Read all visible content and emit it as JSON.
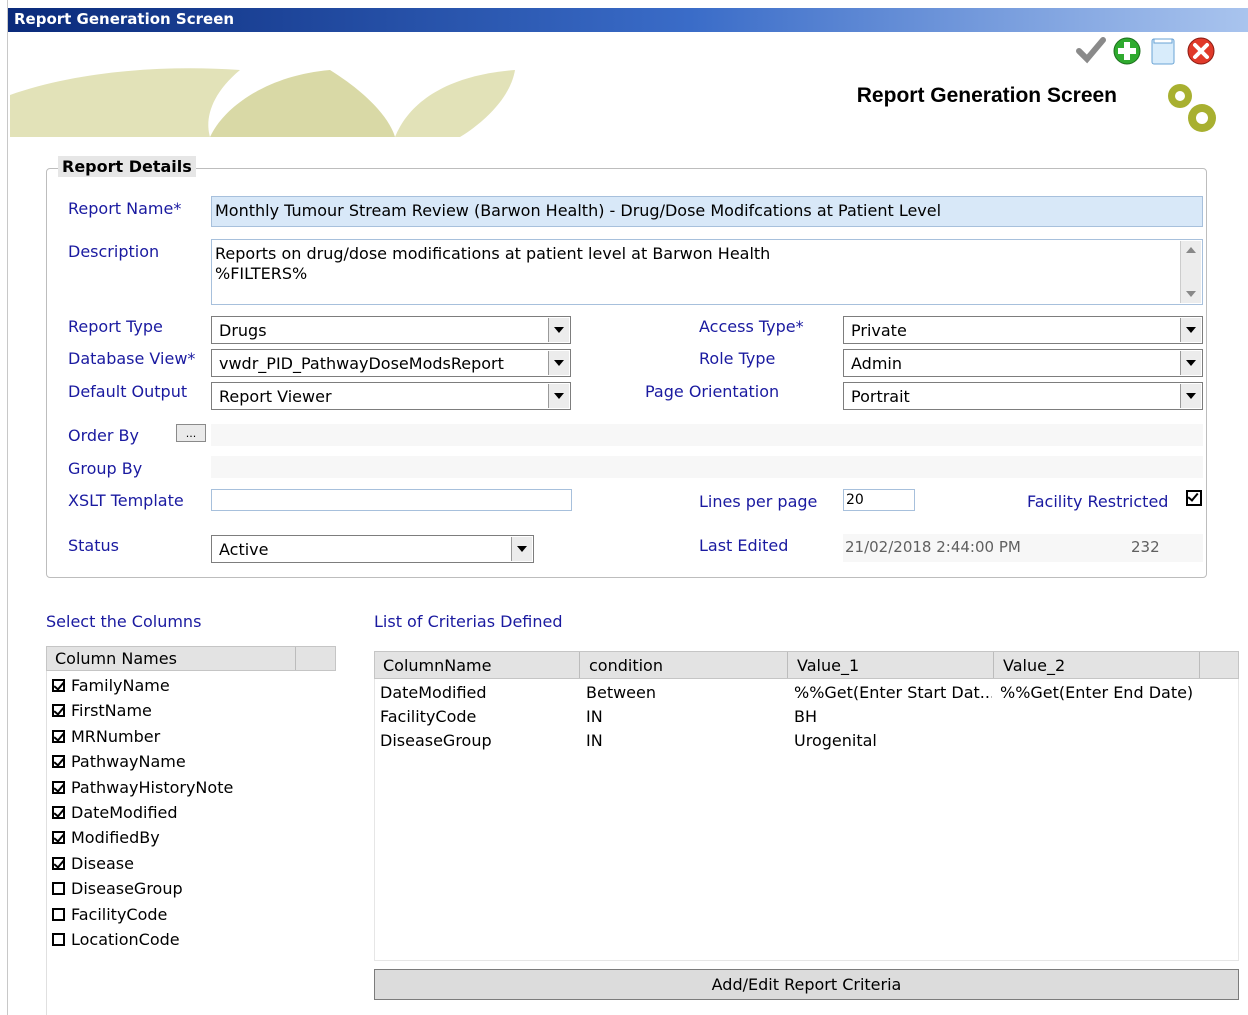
{
  "window": {
    "title": "Report Generation Screen"
  },
  "header": {
    "title": "Report Generation Screen"
  },
  "toolbar": {
    "icons": [
      "save-check-icon",
      "add-icon",
      "clear-icon",
      "close-icon"
    ]
  },
  "details": {
    "group_title": "Report Details",
    "report_name_label": "Report Name*",
    "report_name_value": "Monthly Tumour Stream Review (Barwon Health) - Drug/Dose Modifcations at Patient Level",
    "description_label": "Description",
    "description_line1": "Reports on drug/dose modifications at patient level at Barwon Health",
    "description_line2": "%FILTERS%",
    "report_type_label": "Report Type",
    "report_type_value": "Drugs",
    "database_view_label": "Database View*",
    "database_view_value": "vwdr_PID_PathwayDoseModsReport",
    "default_output_label": "Default Output",
    "default_output_value": "Report Viewer",
    "access_type_label": "Access Type*",
    "access_type_value": "Private",
    "role_type_label": "Role Type",
    "role_type_value": "Admin",
    "page_orientation_label": "Page Orientation",
    "page_orientation_value": "Portrait",
    "order_by_label": "Order By",
    "order_by_button": "...",
    "group_by_label": "Group By",
    "xslt_label": "XSLT Template",
    "lines_per_page_label": "Lines per page",
    "lines_per_page_value": "20",
    "facility_restricted_label": "Facility Restricted",
    "facility_restricted_checked": true,
    "status_label": "Status",
    "status_value": "Active",
    "last_edited_label": "Last Edited",
    "last_edited_value": "21/02/2018 2:44:00 PM",
    "last_edited_id": "232"
  },
  "columns": {
    "title": "Select the Columns",
    "header": "Column Names",
    "items": [
      {
        "name": "FamilyName",
        "checked": true
      },
      {
        "name": "FirstName",
        "checked": true
      },
      {
        "name": "MRNumber",
        "checked": true
      },
      {
        "name": "PathwayName",
        "checked": true
      },
      {
        "name": "PathwayHistoryNote",
        "checked": true
      },
      {
        "name": "DateModified",
        "checked": true
      },
      {
        "name": "ModifiedBy",
        "checked": true
      },
      {
        "name": "Disease",
        "checked": true
      },
      {
        "name": "DiseaseGroup",
        "checked": false
      },
      {
        "name": "FacilityCode",
        "checked": false
      },
      {
        "name": "LocationCode",
        "checked": false
      }
    ]
  },
  "criteria": {
    "title": "List of Criterias Defined",
    "headers": [
      "ColumnName",
      "condition",
      "Value_1",
      "Value_2"
    ],
    "rows": [
      [
        "DateModified",
        "Between",
        "%%Get(Enter Start Dat...",
        "%%Get(Enter End Date)"
      ],
      [
        "FacilityCode",
        "IN",
        "BH",
        ""
      ],
      [
        "DiseaseGroup",
        "IN",
        "Urogenital",
        ""
      ]
    ],
    "button": "Add/Edit Report Criteria"
  }
}
